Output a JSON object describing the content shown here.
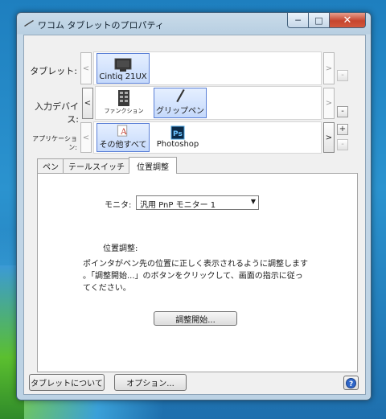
{
  "window": {
    "title": "ワコム タブレットのプロパティ"
  },
  "tablet": {
    "label": "タブレット:",
    "items": [
      {
        "name": "Cintiq 21UX",
        "icon": "tablet-monitor-icon",
        "selected": true
      }
    ],
    "add": "+",
    "remove": "-"
  },
  "input_device": {
    "label": "入力デバイス:",
    "items": [
      {
        "name": "ファンクション",
        "icon": "function-keys-icon",
        "selected": false
      },
      {
        "name": "グリップペン",
        "icon": "pen-icon",
        "selected": true
      }
    ],
    "remove": "-"
  },
  "application": {
    "label": "アプリケーション:",
    "items": [
      {
        "name": "その他すべて",
        "icon": "all-apps-icon",
        "selected": true
      },
      {
        "name": "Photoshop",
        "icon": "photoshop-icon",
        "selected": false
      }
    ],
    "add": "+",
    "remove": "-"
  },
  "tabs": [
    {
      "label": "ペン",
      "active": false
    },
    {
      "label": "テールスイッチ",
      "active": false
    },
    {
      "label": "位置調整",
      "active": true
    }
  ],
  "calibration": {
    "monitor_label": "モニタ:",
    "monitor_value": "汎用 PnP モニター 1",
    "heading": "位置調整:",
    "instructions": [
      "ポインタがペン先の位置に正しく表示されるように調整します",
      "。「調整開始...」のボタンをクリックして、画面の指示に従っ",
      "てください。"
    ],
    "start_button": "調整開始..."
  },
  "footer": {
    "about_button": "タブレットについて",
    "options_button": "オプション...",
    "help": "?"
  },
  "nav": {
    "prev": "<",
    "next": ">"
  },
  "colors": {
    "selection": "#c5d9fb",
    "selection_border": "#5a7fd6",
    "close": "#c6452e"
  }
}
